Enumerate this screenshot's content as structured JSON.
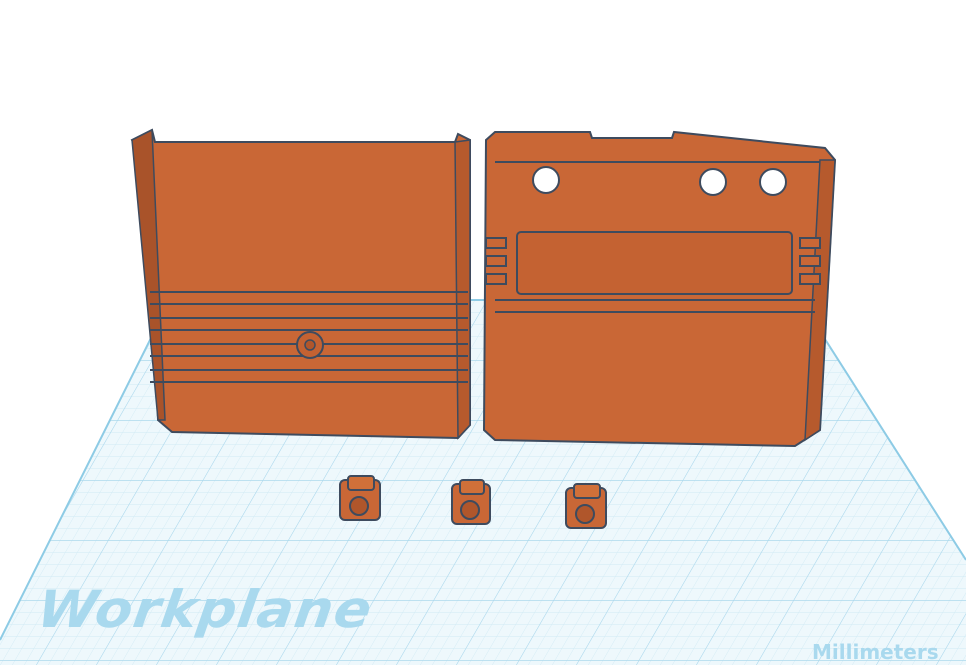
{
  "workplane": {
    "label": "Workplane",
    "unit_label": "Millimeters"
  },
  "colors": {
    "background": "#ffffff",
    "plane_fill": "#eaf6fb",
    "grid_minor": "#cfe9f4",
    "grid_major": "#9fd3ea",
    "plane_edge": "#7fc6e3",
    "part_fill": "#c76534",
    "part_shadow": "#a9532a",
    "part_edge": "#3e4b5e"
  },
  "objects": [
    {
      "name": "cartridge-back-shell"
    },
    {
      "name": "cartridge-front-shell"
    },
    {
      "name": "spacer-clip-1"
    },
    {
      "name": "spacer-clip-2"
    },
    {
      "name": "spacer-clip-3"
    }
  ]
}
